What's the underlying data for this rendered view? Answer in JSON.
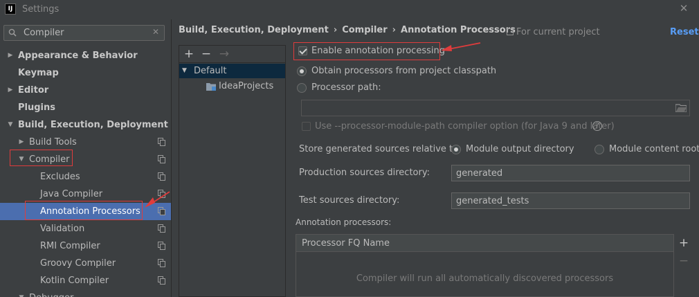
{
  "window": {
    "title": "Settings",
    "app_icon_text": "IJ"
  },
  "search": {
    "value": "Compiler"
  },
  "tree": [
    {
      "label": "Appearance & Behavior",
      "arrow": "▶",
      "bold": true,
      "level": 0
    },
    {
      "label": "Keymap",
      "arrow": "",
      "bold": true,
      "level": 0
    },
    {
      "label": "Editor",
      "arrow": "▶",
      "bold": true,
      "level": 0
    },
    {
      "label": "Plugins",
      "arrow": "",
      "bold": true,
      "level": 0
    },
    {
      "label": "Build, Execution, Deployment",
      "arrow": "▼",
      "bold": true,
      "level": 0
    },
    {
      "label": "Build Tools",
      "arrow": "▶",
      "level": 1,
      "project": true
    },
    {
      "label": "Compiler",
      "arrow": "▼",
      "level": 1,
      "project": true
    },
    {
      "label": "Excludes",
      "arrow": "",
      "level": 2,
      "project": true
    },
    {
      "label": "Java Compiler",
      "arrow": "",
      "level": 2,
      "project": true
    },
    {
      "label": "Annotation Processors",
      "arrow": "",
      "level": 2,
      "project": true,
      "selected": true
    },
    {
      "label": "Validation",
      "arrow": "",
      "level": 2,
      "project": true
    },
    {
      "label": "RMI Compiler",
      "arrow": "",
      "level": 2,
      "project": true
    },
    {
      "label": "Groovy Compiler",
      "arrow": "",
      "level": 2,
      "project": true
    },
    {
      "label": "Kotlin Compiler",
      "arrow": "",
      "level": 2,
      "project": true
    },
    {
      "label": "Debugger",
      "arrow": "▼",
      "level": 1
    }
  ],
  "breadcrumb": [
    "Build, Execution, Deployment",
    "Compiler",
    "Annotation Processors"
  ],
  "for_project": "For current project",
  "reset": "Reset",
  "profiles": {
    "toolbar": {
      "add": "+",
      "remove": "−",
      "move": "→"
    },
    "default_label": "Default",
    "module_label": "IdeaProjects"
  },
  "form": {
    "enable_label": "Enable annotation processing",
    "enable_checked": true,
    "obtain_classpath_label": "Obtain processors from project classpath",
    "processor_path_label": "Processor path:",
    "processor_path_value": "",
    "module_path_label": "Use --processor-module-path compiler option (for Java 9 and later)",
    "store_label": "Store generated sources relative to:",
    "module_output_label": "Module output directory",
    "module_content_label": "Module content root",
    "production_label": "Production sources directory:",
    "production_value": "generated",
    "test_label": "Test sources directory:",
    "test_value": "generated_tests",
    "processors_section": "Annotation processors:",
    "table_header": "Processor FQ Name",
    "table_empty": "Compiler will run all automatically discovered processors",
    "add": "+",
    "remove": "−"
  },
  "colors": {
    "background": "#3c3f41",
    "selection": "#4b6eaf",
    "accent_link": "#589df6",
    "annotation_red": "#e03c3c"
  }
}
